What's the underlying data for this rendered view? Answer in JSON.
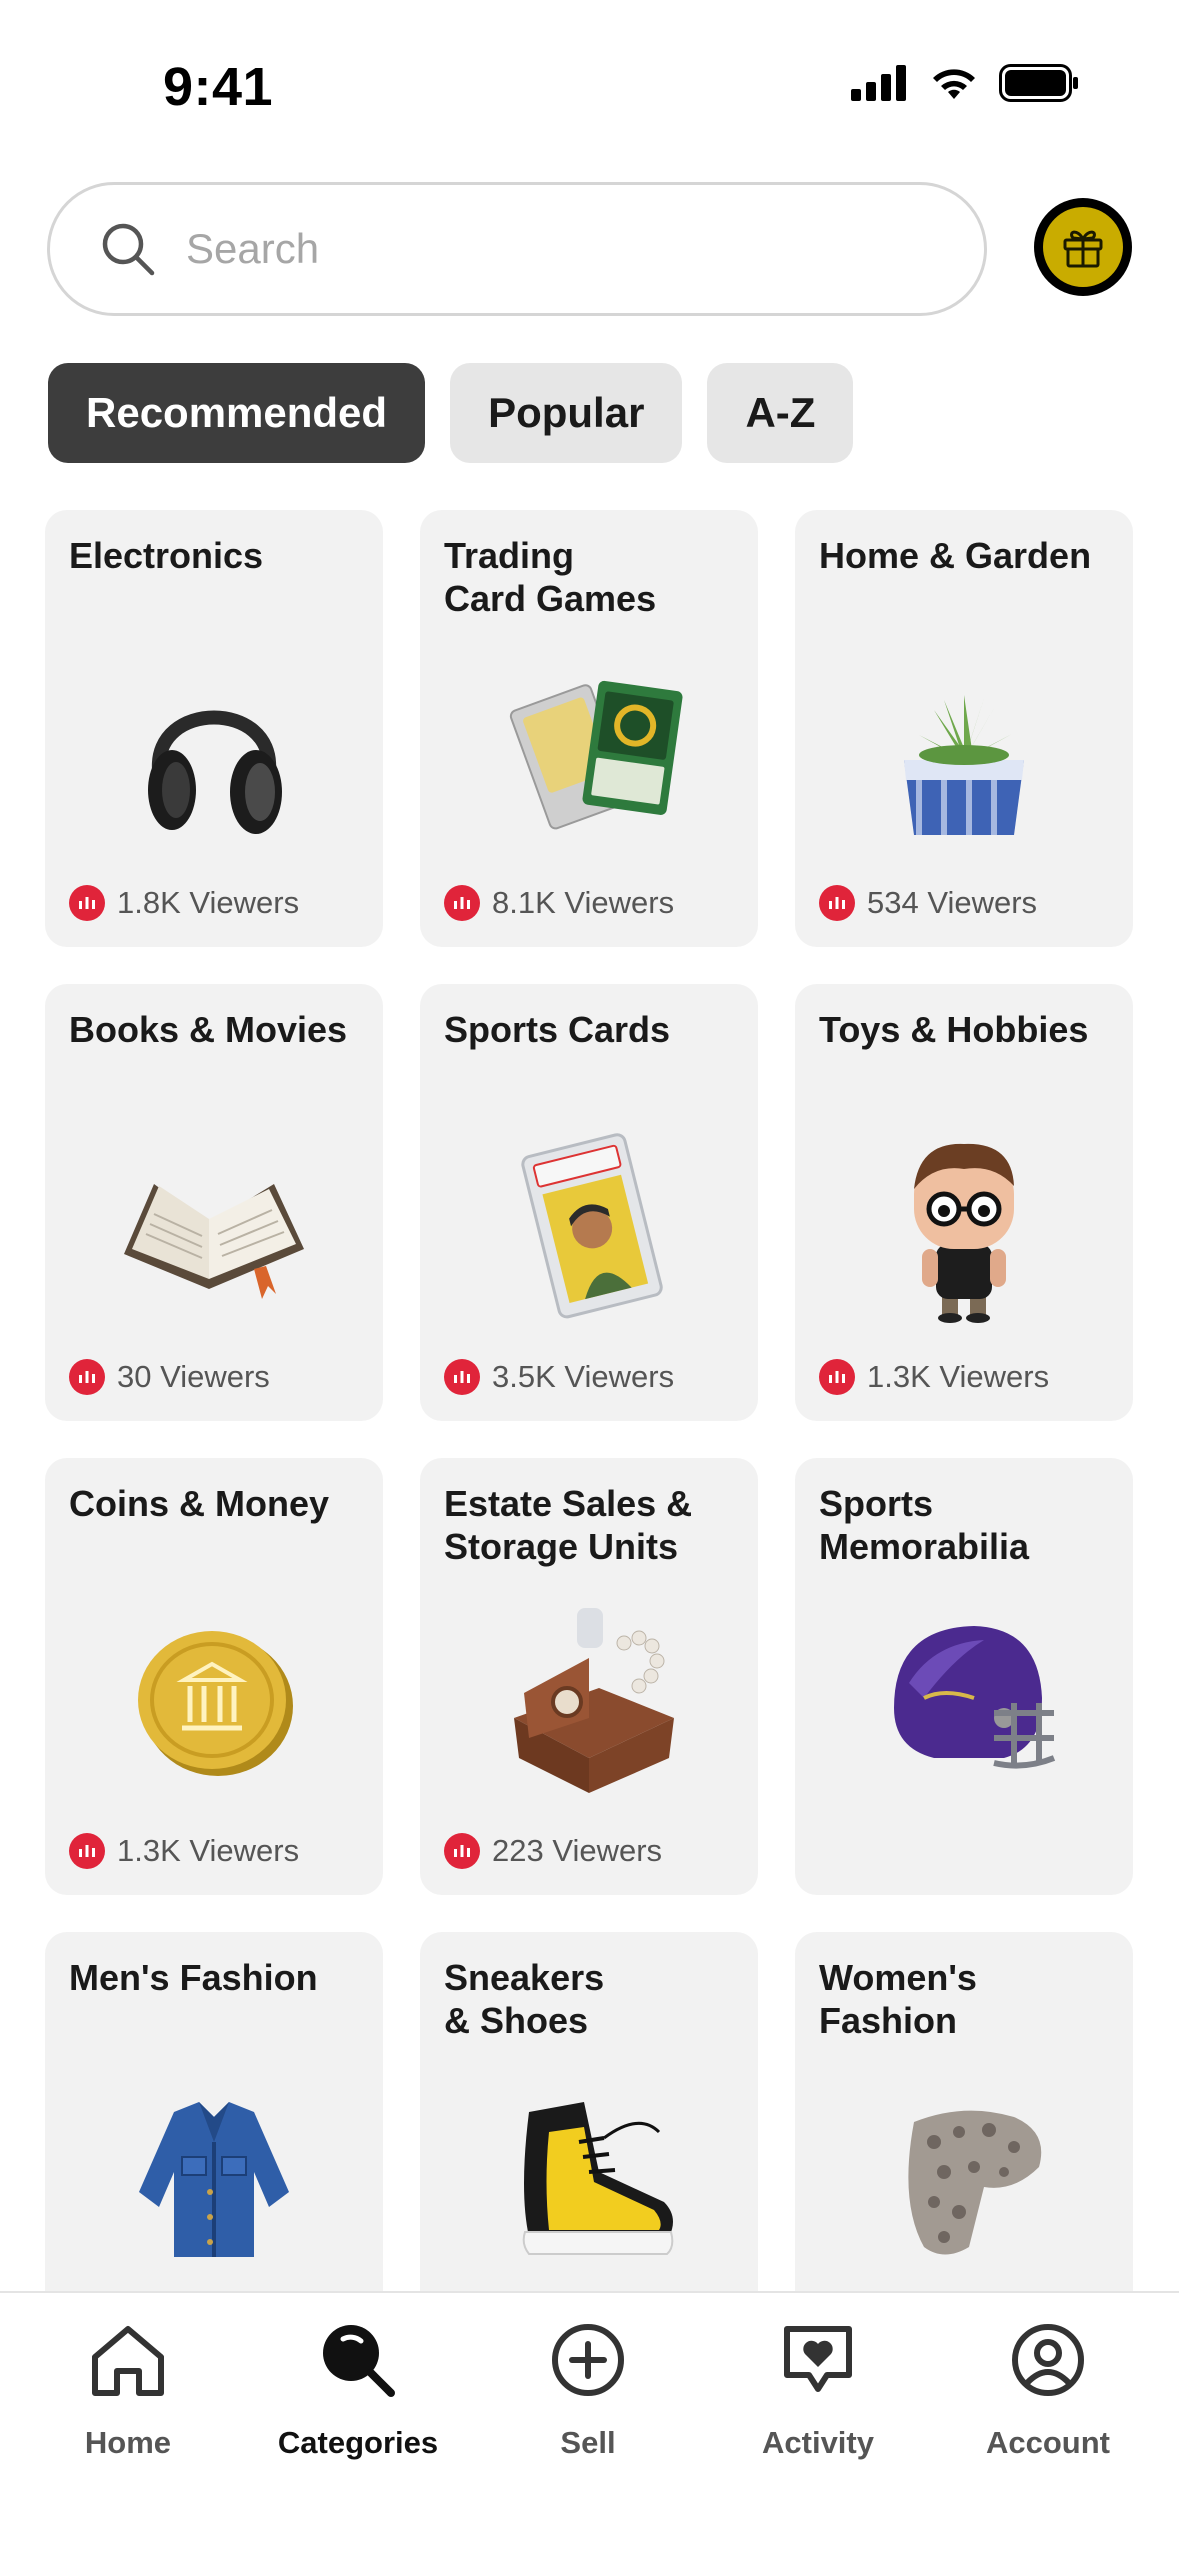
{
  "status_bar": {
    "time": "9:41",
    "icons": [
      "cellular-icon",
      "wifi-icon",
      "battery-icon"
    ]
  },
  "search": {
    "placeholder": "Search",
    "value": ""
  },
  "gift_button": {
    "icon": "gift-icon",
    "accent": "#c9ac00"
  },
  "tabs": [
    {
      "label": "Recommended",
      "active": true
    },
    {
      "label": "Popular",
      "active": false
    },
    {
      "label": "A-Z",
      "active": false
    }
  ],
  "categories": [
    {
      "title": "Electronics",
      "viewers": "1.8K Viewers",
      "icon": "headphones-icon"
    },
    {
      "title": "Trading\nCard Games",
      "viewers": "8.1K Viewers",
      "icon": "trading-cards-icon"
    },
    {
      "title": "Home & Garden",
      "viewers": "534 Viewers",
      "icon": "potted-succulent-icon"
    },
    {
      "title": "Books & Movies",
      "viewers": "30 Viewers",
      "icon": "open-book-icon"
    },
    {
      "title": "Sports Cards",
      "viewers": "3.5K Viewers",
      "icon": "graded-sports-card-icon"
    },
    {
      "title": "Toys & Hobbies",
      "viewers": "1.3K Viewers",
      "icon": "vinyl-figure-icon"
    },
    {
      "title": "Coins & Money",
      "viewers": "1.3K Viewers",
      "icon": "gold-coin-icon"
    },
    {
      "title": "Estate Sales &\nStorage Units",
      "viewers": "223 Viewers",
      "icon": "vintage-trunk-icon"
    },
    {
      "title": "Sports\nMemorabilia",
      "viewers": "",
      "icon": "football-helmet-icon"
    },
    {
      "title": "Men's Fashion",
      "viewers": "",
      "icon": "denim-jacket-icon"
    },
    {
      "title": "Sneakers\n& Shoes",
      "viewers": "",
      "icon": "sneaker-icon"
    },
    {
      "title": "Women's\nFashion",
      "viewers": "",
      "icon": "fur-sweater-icon"
    }
  ],
  "bottom_nav": [
    {
      "label": "Home",
      "icon": "home-icon",
      "active": false
    },
    {
      "label": "Categories",
      "icon": "categories-search-icon",
      "active": true
    },
    {
      "label": "Sell",
      "icon": "plus-circle-icon",
      "active": false
    },
    {
      "label": "Activity",
      "icon": "heart-chat-icon",
      "active": false
    },
    {
      "label": "Account",
      "icon": "account-icon",
      "active": false
    }
  ],
  "colors": {
    "live_badge": "#e0243a",
    "active_tab": "#3d3d3d",
    "card_bg": "#f2f2f2",
    "gift_yellow": "#c9ac00"
  }
}
